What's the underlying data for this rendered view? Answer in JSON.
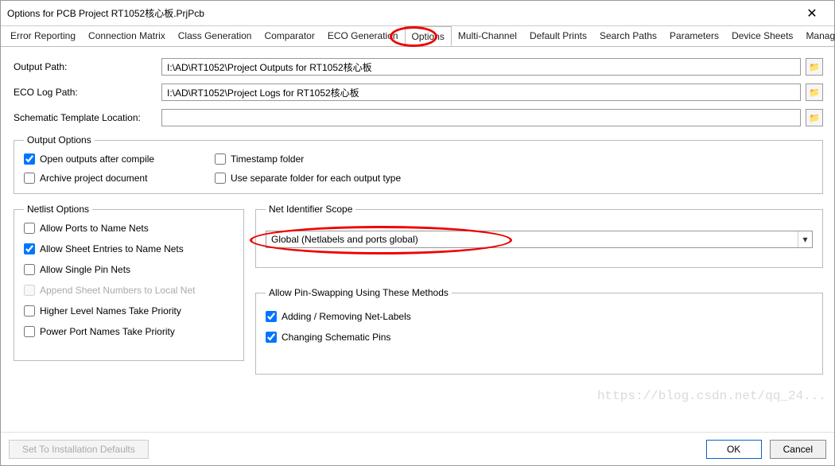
{
  "window": {
    "title": "Options for PCB Project RT1052核心板.PrjPcb"
  },
  "tabs": {
    "items": [
      "Error Reporting",
      "Connection Matrix",
      "Class Generation",
      "Comparator",
      "ECO Generation",
      "Options",
      "Multi-Channel",
      "Default Prints",
      "Search Paths",
      "Parameters",
      "Device Sheets",
      "Managed O"
    ],
    "active_index": 5
  },
  "paths": {
    "output_label": "Output Path:",
    "output_value": "I:\\AD\\RT1052\\Project Outputs for RT1052核心板",
    "eco_label": "ECO Log Path:",
    "eco_value": "I:\\AD\\RT1052\\Project Logs for RT1052核心板",
    "schematic_label": "Schematic Template Location:",
    "schematic_value": ""
  },
  "output_options": {
    "legend": "Output Options",
    "open_after": "Open outputs after compile",
    "timestamp": "Timestamp folder",
    "archive": "Archive project document",
    "separate": "Use separate folder for each output type",
    "checked": {
      "open_after": true,
      "timestamp": false,
      "archive": false,
      "separate": false
    }
  },
  "netlist": {
    "legend": "Netlist Options",
    "ports": "Allow Ports to Name Nets",
    "sheet_entries": "Allow Sheet Entries to Name Nets",
    "single_pin": "Allow Single Pin Nets",
    "append": "Append Sheet Numbers to Local Net",
    "higher": "Higher Level Names Take Priority",
    "power": "Power Port Names Take Priority",
    "checked": {
      "ports": false,
      "sheet_entries": true,
      "single_pin": false,
      "append": false,
      "higher": false,
      "power": false
    }
  },
  "scope": {
    "legend": "Net Identifier Scope",
    "selected": "Global (Netlabels and ports global)"
  },
  "pinswap": {
    "legend": "Allow Pin-Swapping Using These Methods",
    "adding": "Adding / Removing Net-Labels",
    "changing": "Changing Schematic Pins",
    "checked": {
      "adding": true,
      "changing": true
    }
  },
  "footer": {
    "defaults": "Set To Installation Defaults",
    "ok": "OK",
    "cancel": "Cancel"
  },
  "watermark": "https://blog.csdn.net/qq_24..."
}
